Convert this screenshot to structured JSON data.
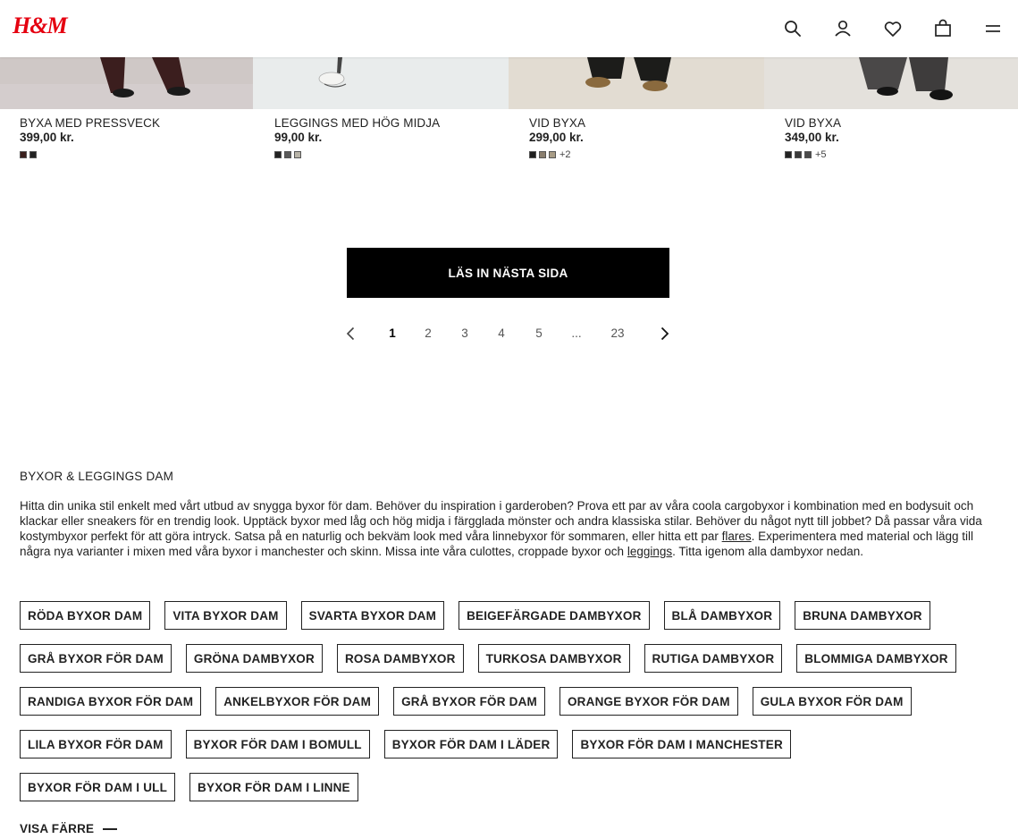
{
  "header": {
    "logo": "H&M",
    "icons": [
      "search-icon",
      "account-icon",
      "favorites-icon",
      "bag-icon",
      "menu-icon"
    ]
  },
  "products": [
    {
      "name": "BYXA MED PRESSVECK",
      "price": "399,00 kr.",
      "swatches": [
        "#3a1f1c",
        "#222222"
      ],
      "more": ""
    },
    {
      "name": "LEGGINGS MED HÖG MIDJA",
      "price": "99,00 kr.",
      "swatches": [
        "#222222",
        "#5a5a5a",
        "#b8b4a8"
      ],
      "more": ""
    },
    {
      "name": "VID BYXA",
      "price": "299,00 kr.",
      "swatches": [
        "#1f1f1f",
        "#8a7e6e",
        "#a89c86"
      ],
      "more": "+2"
    },
    {
      "name": "VID BYXA",
      "price": "349,00 kr.",
      "swatches": [
        "#222222",
        "#3a3a3a",
        "#4a4a4a"
      ],
      "more": "+5"
    }
  ],
  "load_more": {
    "label": "LÄS IN NÄSTA SIDA"
  },
  "pagination": {
    "pages": [
      "1",
      "2",
      "3",
      "4",
      "5",
      "...",
      "23"
    ],
    "current": "1"
  },
  "seo": {
    "title": "BYXOR & LEGGINGS DAM",
    "text_1": "Hitta din unika stil enkelt med vårt utbud av snygga byxor för dam. Behöver du inspiration i garderoben? Prova ett par av våra coola cargobyxor i kombination med en bodysuit och klackar eller sneakers för en trendig look. Upptäck byxor med låg och hög midja i färgglada mönster och andra klassiska stilar. Behöver du något nytt till jobbet? Då passar våra vida kostymbyxor perfekt för att göra intryck. Satsa på en naturlig och bekväm look med våra linnebyxor för sommaren, eller hitta ett par ",
    "link_1": "flares",
    "text_2": ". Experimentera med material och lägg till några nya varianter i mixen med våra byxor i manchester och skinn. Missa inte våra culottes, croppade byxor och ",
    "link_2": "leggings",
    "text_3": ". Titta igenom alla dambyxor nedan."
  },
  "tags": [
    [
      "RÖDA BYXOR DAM",
      "VITA BYXOR DAM",
      "SVARTA BYXOR DAM",
      "BEIGEFÄRGADE DAMBYXOR",
      "BLÅ DAMBYXOR",
      "BRUNA DAMBYXOR"
    ],
    [
      "GRÅ BYXOR FÖR DAM",
      "GRÖNA DAMBYXOR",
      "ROSA DAMBYXOR",
      "TURKOSA DAMBYXOR",
      "RUTIGA DAMBYXOR",
      "BLOMMIGA DAMBYXOR"
    ],
    [
      "RANDIGA BYXOR FÖR DAM",
      "ANKELBYXOR FÖR DAM",
      "GRÅ BYXOR FÖR DAM",
      "ORANGE BYXOR FÖR DAM",
      "GULA BYXOR FÖR DAM"
    ],
    [
      "LILA BYXOR FÖR DAM",
      "BYXOR FÖR DAM I BOMULL",
      "BYXOR FÖR DAM I LÄDER",
      "BYXOR FÖR DAM I MANCHESTER"
    ],
    [
      "BYXOR FÖR DAM I ULL",
      "BYXOR FÖR DAM I LINNE"
    ]
  ],
  "show_less": {
    "label": "VISA FÄRRE"
  },
  "colors": {
    "brand": "#e50010",
    "button": "#000000"
  }
}
